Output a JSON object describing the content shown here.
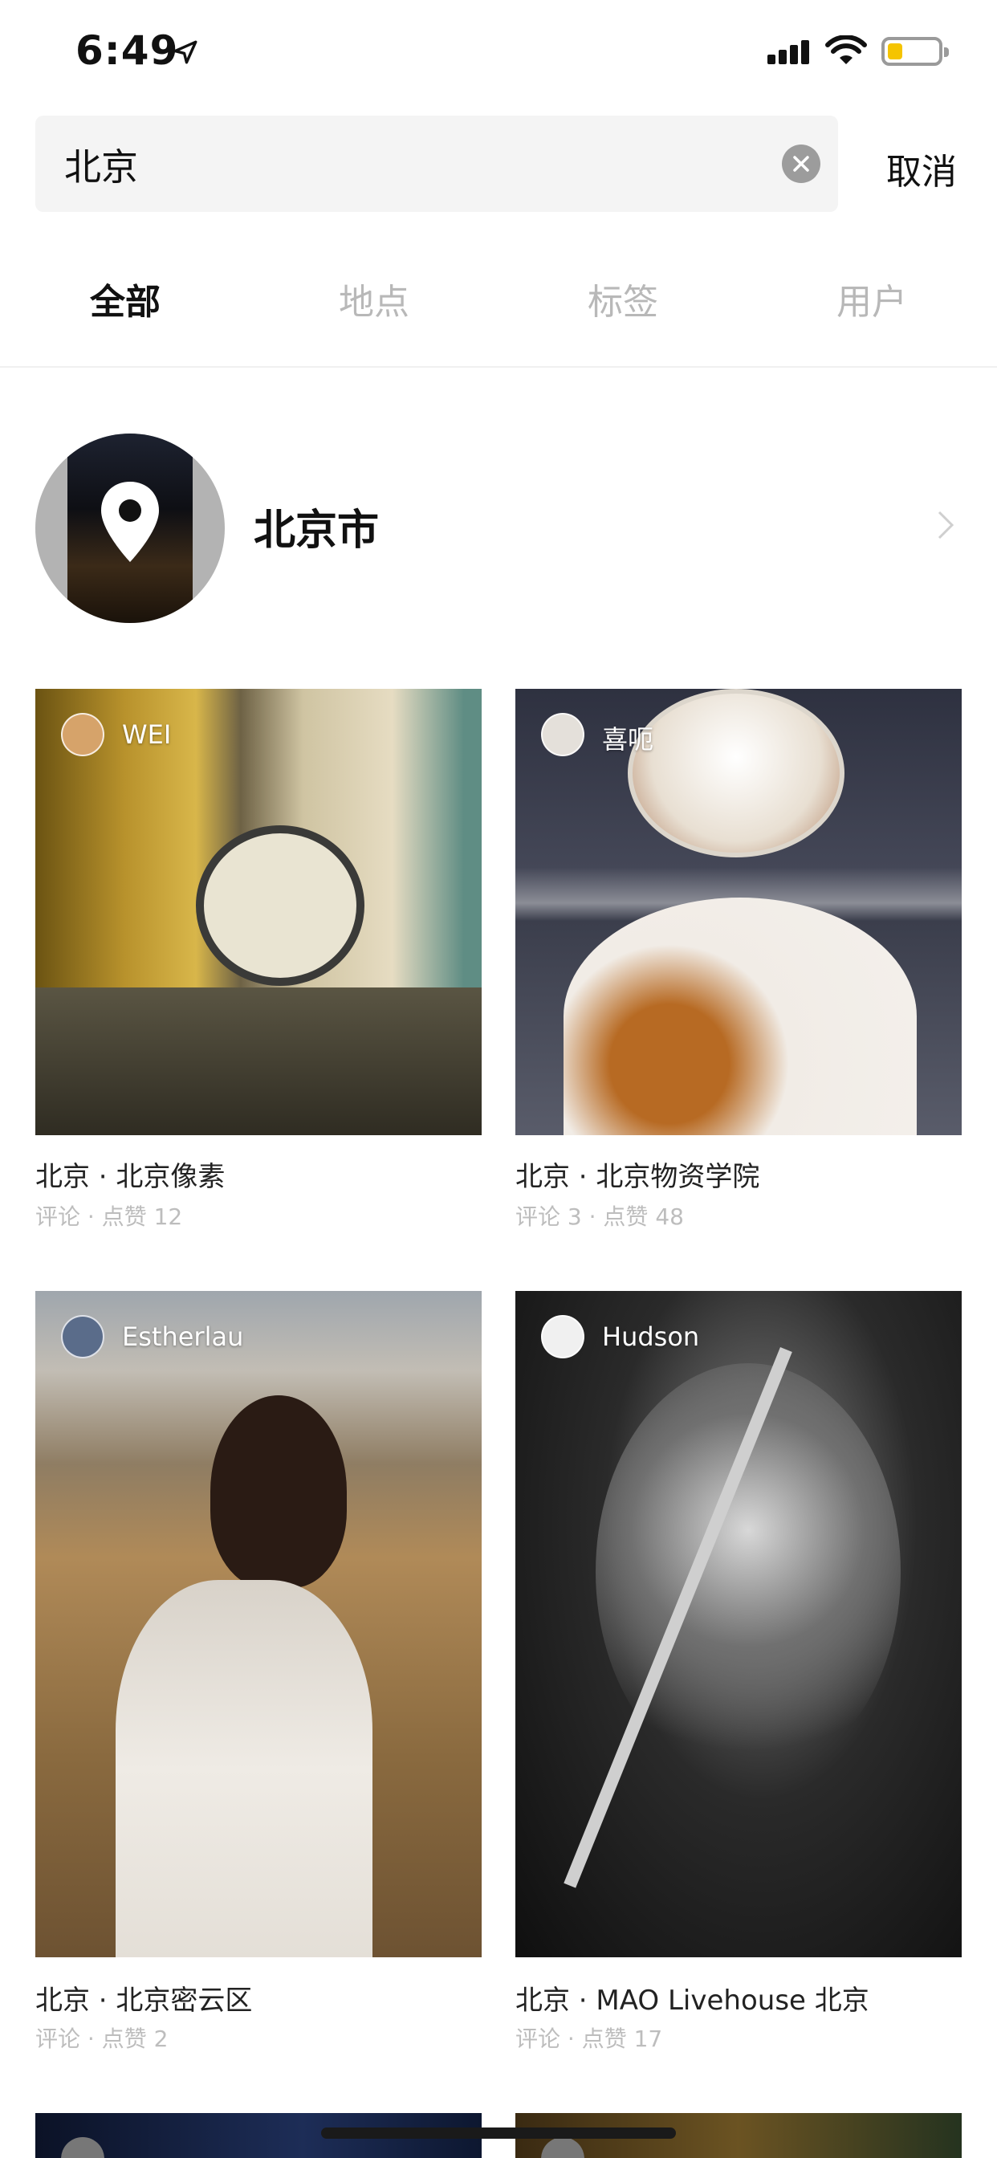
{
  "status_bar": {
    "time": "6:49"
  },
  "search": {
    "value": "北京",
    "cancel_label": "取消"
  },
  "tabs": [
    {
      "label": "全部",
      "active": true
    },
    {
      "label": "地点",
      "active": false
    },
    {
      "label": "标签",
      "active": false
    },
    {
      "label": "用户",
      "active": false
    }
  ],
  "location_result": {
    "name": "北京市"
  },
  "posts": [
    {
      "user": "WEI",
      "title": "北京 · 北京像素",
      "meta": "评论 · 点赞 12"
    },
    {
      "user": "喜呃",
      "title": "北京 · 北京物资学院",
      "meta": "评论 3 · 点赞 48"
    },
    {
      "user": "Estherlau",
      "title": "北京 · 北京密云区",
      "meta": "评论 · 点赞 2"
    },
    {
      "user": "Hudson",
      "title": "北京 · MAO Livehouse 北京",
      "meta": "评论 · 点赞 17"
    }
  ],
  "colors": {
    "text": "#111111",
    "muted": "#b8b8b8",
    "meta": "#bdbdbd",
    "search_bg": "#f4f4f4",
    "battery": "#f5c400"
  }
}
